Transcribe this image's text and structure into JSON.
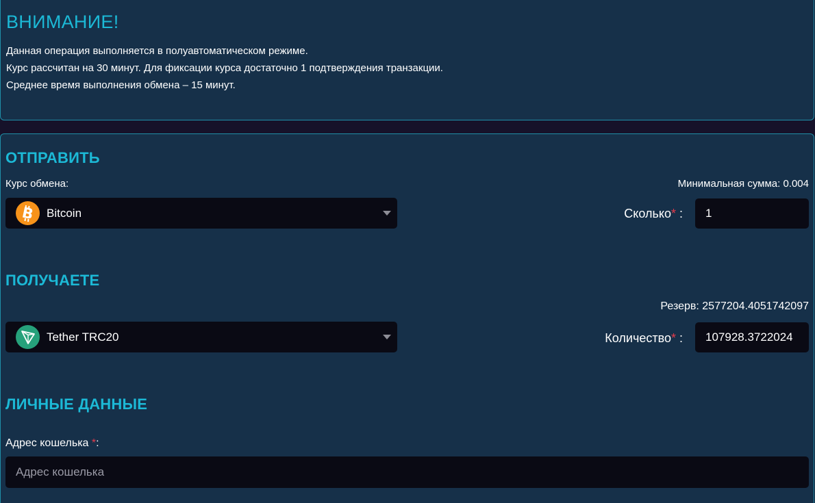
{
  "notice": {
    "title": "ВНИМАНИЕ!",
    "lines": [
      "Данная операция выполняется в полуавтоматическом режиме.",
      "Курс рассчитан на 30 минут. Для фиксации курса достаточно 1 подтверждения транзакции.",
      "Среднее время выполнения обмена – 15 минут."
    ]
  },
  "send": {
    "title": "ОТПРАВИТЬ",
    "rate_label": "Курс обмена:",
    "min_label": "Минимальная сумма: 0.004",
    "currency": "Bitcoin",
    "currency_icon": "bitcoin-icon",
    "amount_label": "Сколько",
    "amount_value": "1"
  },
  "receive": {
    "title": "ПОЛУЧАЕТЕ",
    "reserve_label": "Резерв: 2577204.4051742097",
    "currency": "Tether TRC20",
    "currency_icon": "tron-icon",
    "amount_label": "Количество",
    "amount_value": "107928.3722024"
  },
  "personal": {
    "title": "ЛИЧНЫЕ ДАННЫЕ",
    "wallet_label": "Адрес кошелька ",
    "wallet_placeholder": "Адрес кошелька",
    "wallet_value": ""
  },
  "common": {
    "star": "*",
    "colon": ":",
    "colon_spaced": " :"
  },
  "colors": {
    "accent": "#1cb9d6",
    "panel": "#163049",
    "input_bg": "#0a0a14",
    "required": "#e53b4b",
    "btc": "#f7931a",
    "usdt": "#26a17b"
  }
}
